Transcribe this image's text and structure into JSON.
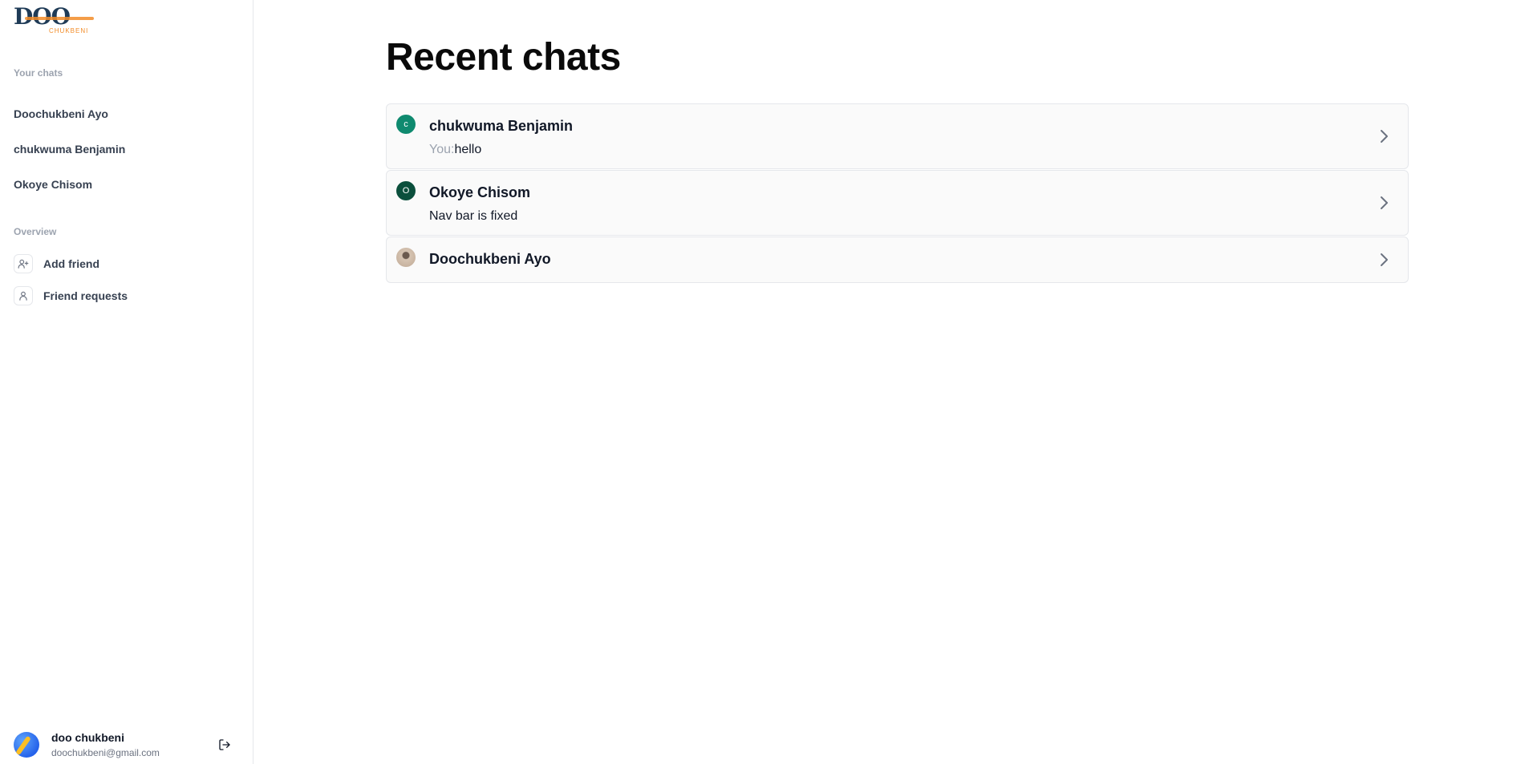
{
  "logo": {
    "mark": "DOO",
    "sub": "CHUKBENI"
  },
  "sidebar": {
    "chats_label": "Your chats",
    "chats": [
      {
        "label": "Doochukbeni Ayo"
      },
      {
        "label": "chukwuma Benjamin"
      },
      {
        "label": "Okoye Chisom"
      }
    ],
    "overview_label": "Overview",
    "overview": [
      {
        "label": "Add friend",
        "icon": "user-plus-icon"
      },
      {
        "label": "Friend requests",
        "icon": "user-icon"
      }
    ]
  },
  "profile": {
    "name": "doo chukbeni",
    "email": "doochukbeni@gmail.com",
    "logout_icon": "logout-icon"
  },
  "main": {
    "title": "Recent chats",
    "chats": [
      {
        "name": "chukwuma Benjamin",
        "initial": "c",
        "avatar_color": "#0f8a6f",
        "prefix": "You:",
        "message": "hello"
      },
      {
        "name": "Okoye Chisom",
        "initial": "O",
        "avatar_color": "#0b4f3c",
        "prefix": "",
        "message": "Nav bar is fixed"
      },
      {
        "name": "Doochukbeni Ayo",
        "initial": "",
        "avatar_color": "#c8b4a0",
        "prefix": "",
        "message": ""
      }
    ]
  }
}
